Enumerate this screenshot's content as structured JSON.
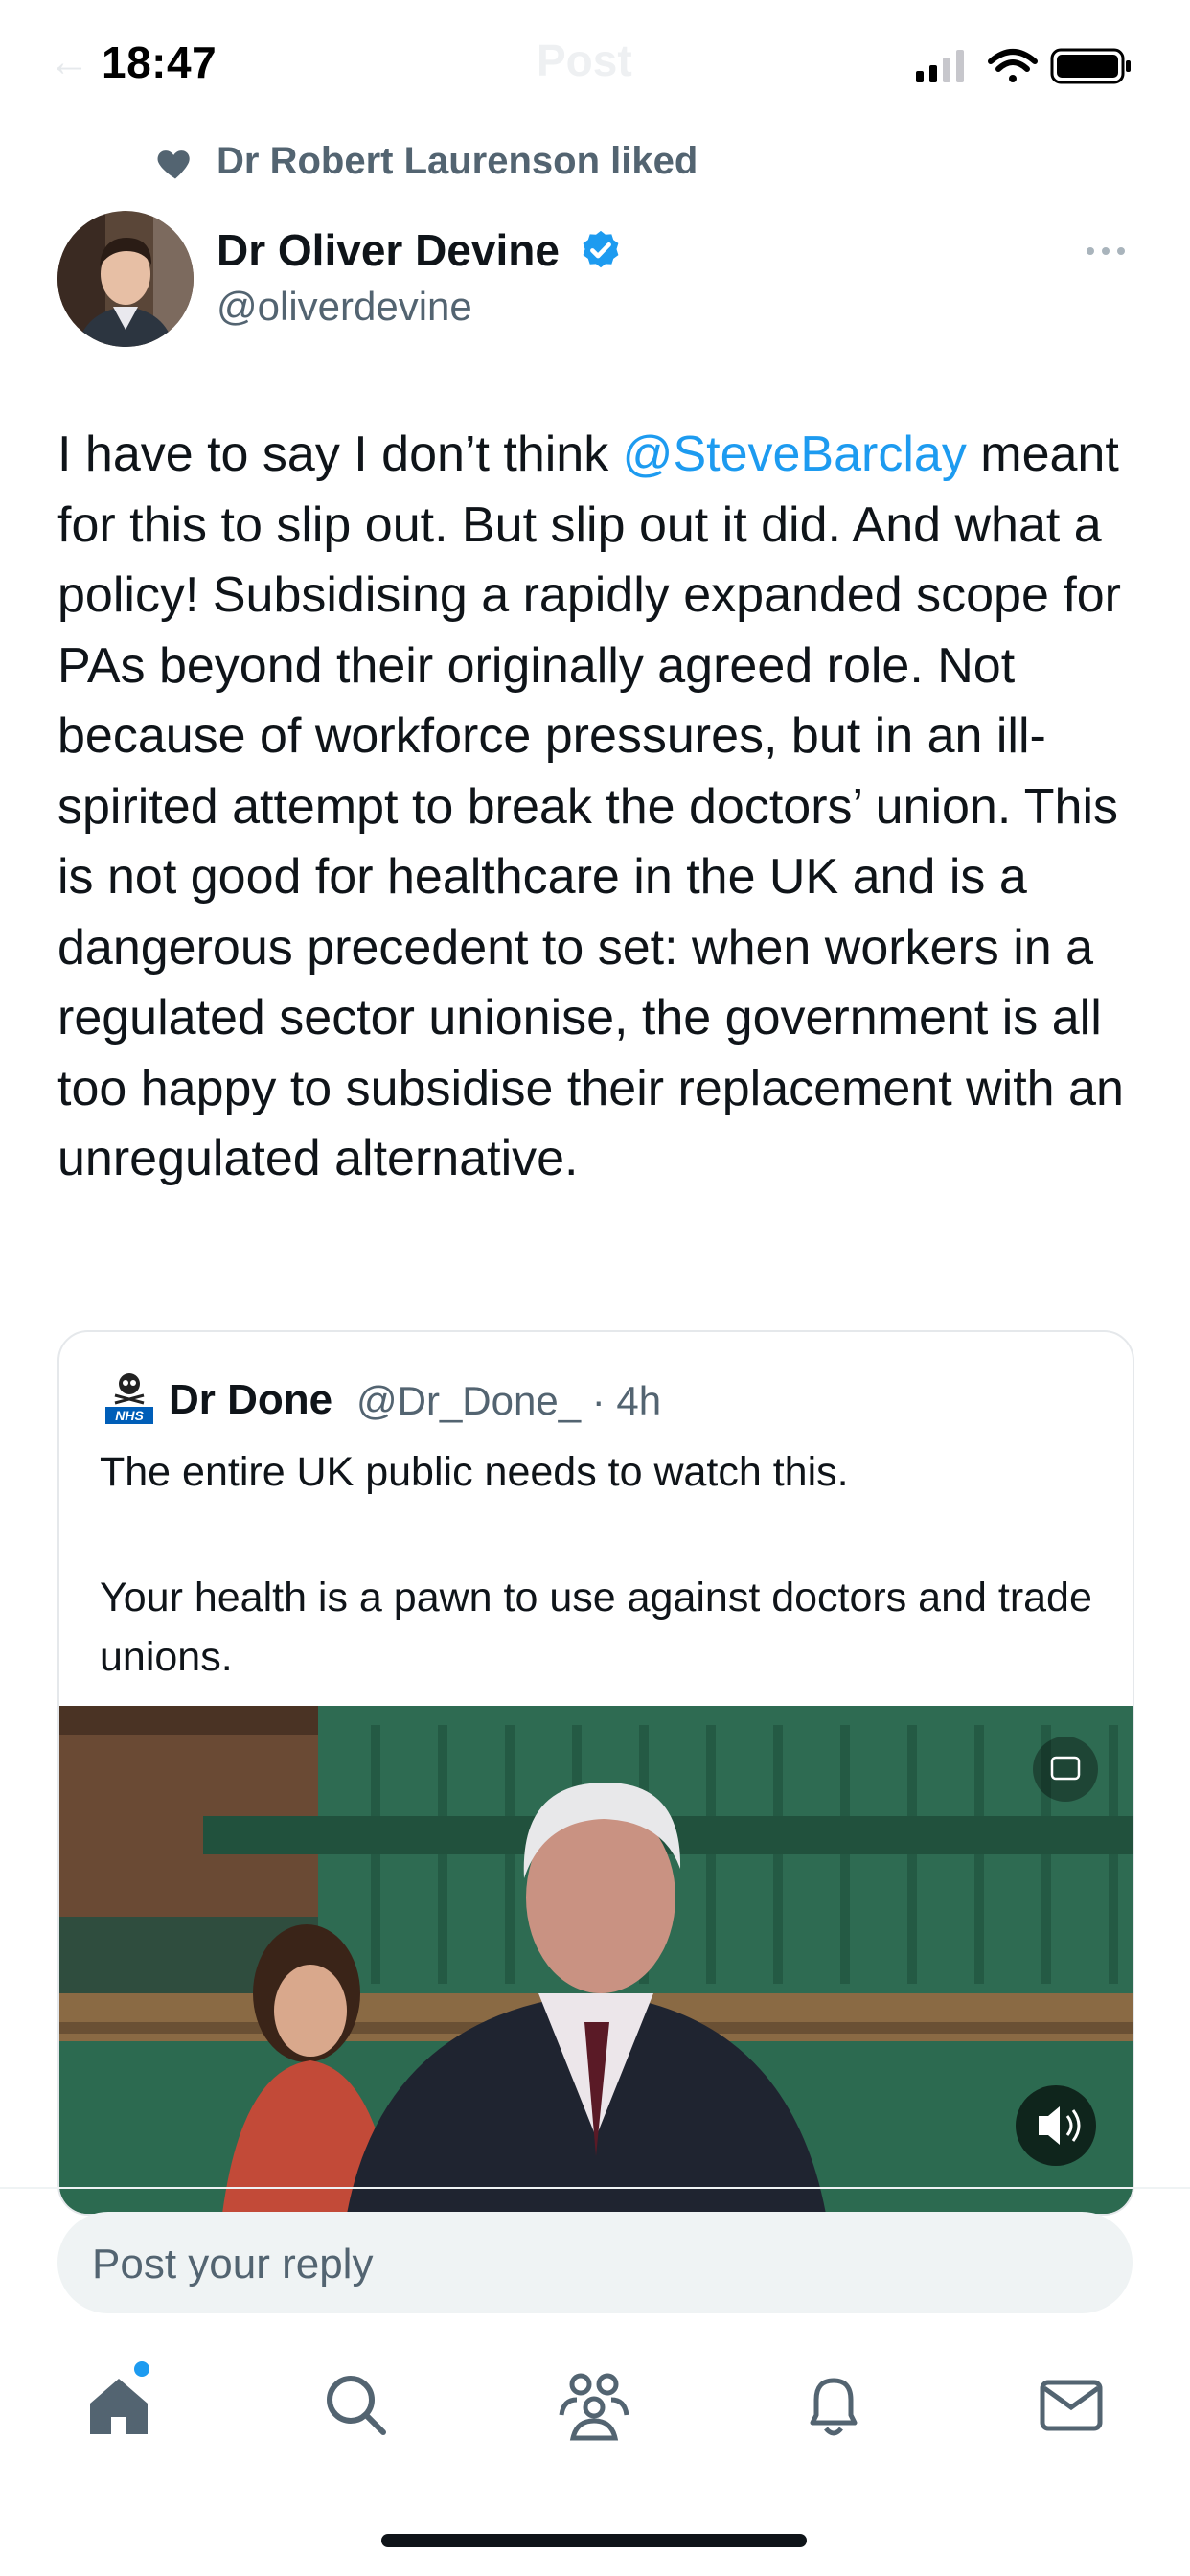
{
  "status_bar": {
    "time": "18:47"
  },
  "header": {
    "title": "Post"
  },
  "social_context": {
    "text": "Dr Robert Laurenson liked",
    "icon": "heart-icon"
  },
  "post": {
    "author_name": "Dr Oliver Devine",
    "author_handle": "@oliverdevine",
    "verified": true,
    "text_before_mention": "I have to say I don’t think ",
    "mention": "@SteveBarclay",
    "text_after_mention": " meant for this to slip out. But slip out it did. And what a policy! Subsidising a rapidly expanded scope for PAs beyond their originally agreed role. Not because of workforce pressures, but in an ill-spirited attempt to break the doctors’ union. This is not good for healthcare in the UK and is a dangerous precedent to set: when workers in a regulated sector unionise, the government is all too happy to subsidise their replacement with an unregulated alternative."
  },
  "quoted_post": {
    "author_name": "Dr Done",
    "author_handle": "@Dr_Done_ · 4h",
    "line1": "The entire UK public needs to watch this.",
    "line2": "Your health is a pawn to use against doctors and trade unions.",
    "logo_text": "NHS"
  },
  "reply": {
    "placeholder": "Post your reply"
  },
  "tab_bar": {
    "items": [
      "home-icon",
      "search-icon",
      "communities-icon",
      "notifications-icon",
      "messages-icon"
    ]
  },
  "colors": {
    "accent": "#1d9bf0",
    "secondary_text": "#536471",
    "primary_text": "#0f1419"
  }
}
